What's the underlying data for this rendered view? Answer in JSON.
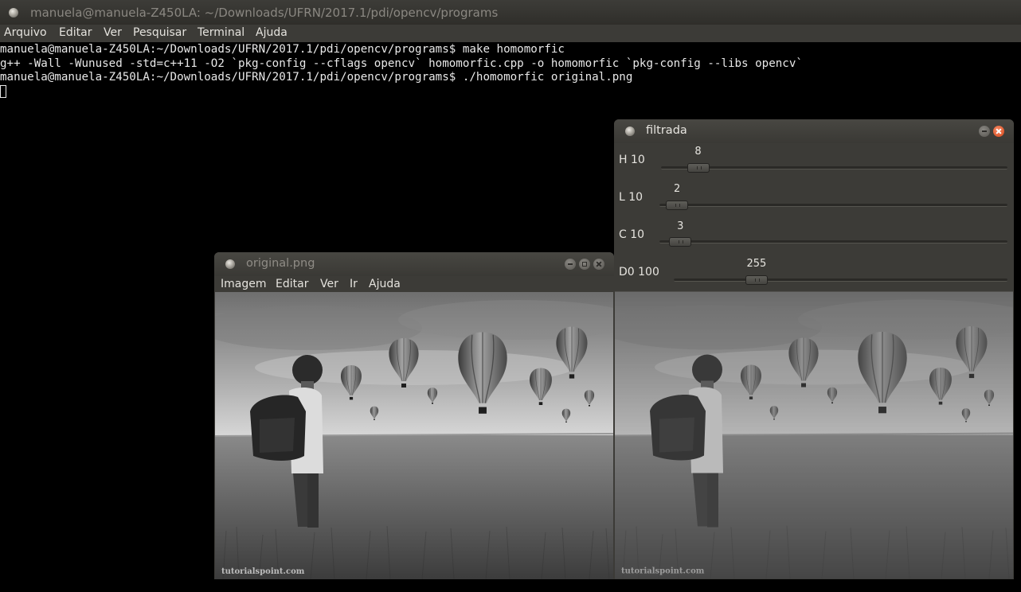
{
  "terminal": {
    "title": "manuela@manuela-Z450LA: ~/Downloads/UFRN/2017.1/pdi/opencv/programs",
    "menu": [
      "Arquivo",
      "Editar",
      "Ver",
      "Pesquisar",
      "Terminal",
      "Ajuda"
    ],
    "lines": [
      "manuela@manuela-Z450LA:~/Downloads/UFRN/2017.1/pdi/opencv/programs$ make homomorfic",
      "g++ -Wall -Wunused -std=c++11 -O2 `pkg-config --cflags opencv` homomorfic.cpp -o homomorfic `pkg-config --libs opencv`",
      "manuela@manuela-Z450LA:~/Downloads/UFRN/2017.1/pdi/opencv/programs$ ./homomorfic original.png"
    ]
  },
  "original_window": {
    "title": "original.png",
    "menu": [
      "Imagem",
      "Editar",
      "Ver",
      "Ir",
      "Ajuda"
    ],
    "watermark": "tutorialspoint.com"
  },
  "filtered_window": {
    "title": "filtrada",
    "trackbars": [
      {
        "label": "H 10",
        "value": "8",
        "fraction": 0.08
      },
      {
        "label": "L 10",
        "value": "2",
        "fraction": 0.02
      },
      {
        "label": "C 10",
        "value": "3",
        "fraction": 0.03
      },
      {
        "label": "D0 100",
        "value": "255",
        "fraction": 0.23
      }
    ],
    "watermark": "tutorialspoint.com"
  },
  "colors": {
    "terminal_bg": "#000000",
    "window_chrome": "#3c3b37",
    "close_accent": "#e3541f"
  }
}
